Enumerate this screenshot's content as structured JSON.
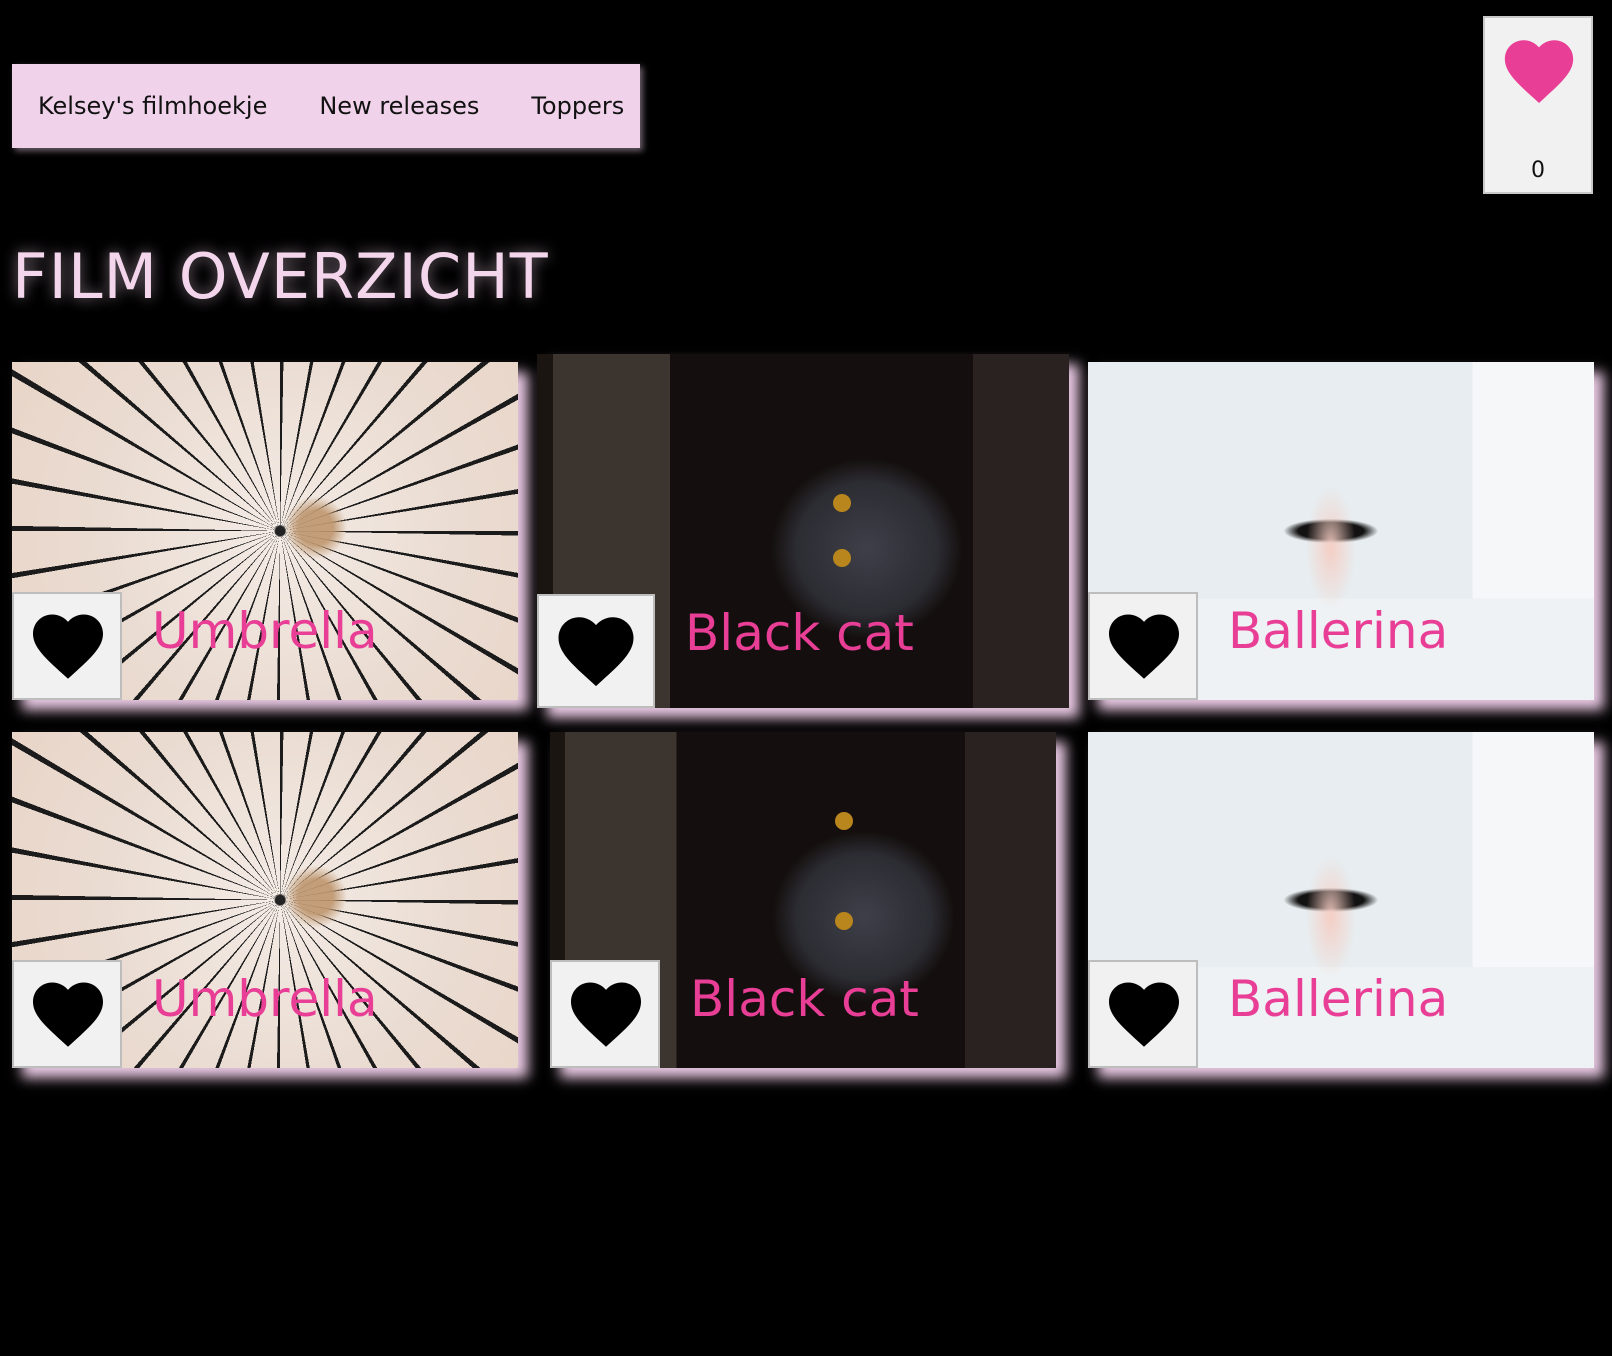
{
  "nav": {
    "items": [
      {
        "label": "Kelsey's filmhoekje"
      },
      {
        "label": "New releases"
      },
      {
        "label": "Toppers"
      }
    ]
  },
  "favorites": {
    "count": "0",
    "icon": "heart-icon",
    "color": "#e83e96"
  },
  "page": {
    "title": "FILM OVERZICHT"
  },
  "films": [
    {
      "title": "Umbrella",
      "like_icon": "heart-icon"
    },
    {
      "title": "Black cat",
      "like_icon": "heart-icon"
    },
    {
      "title": "Ballerina",
      "like_icon": "heart-icon"
    },
    {
      "title": "Umbrella",
      "like_icon": "heart-icon"
    },
    {
      "title": "Black cat",
      "like_icon": "heart-icon"
    },
    {
      "title": "Ballerina",
      "like_icon": "heart-icon"
    }
  ],
  "colors": {
    "background": "#000000",
    "nav_bg": "#f0d3ea",
    "title": "#f3d6ec",
    "film_title": "#e83e96"
  }
}
